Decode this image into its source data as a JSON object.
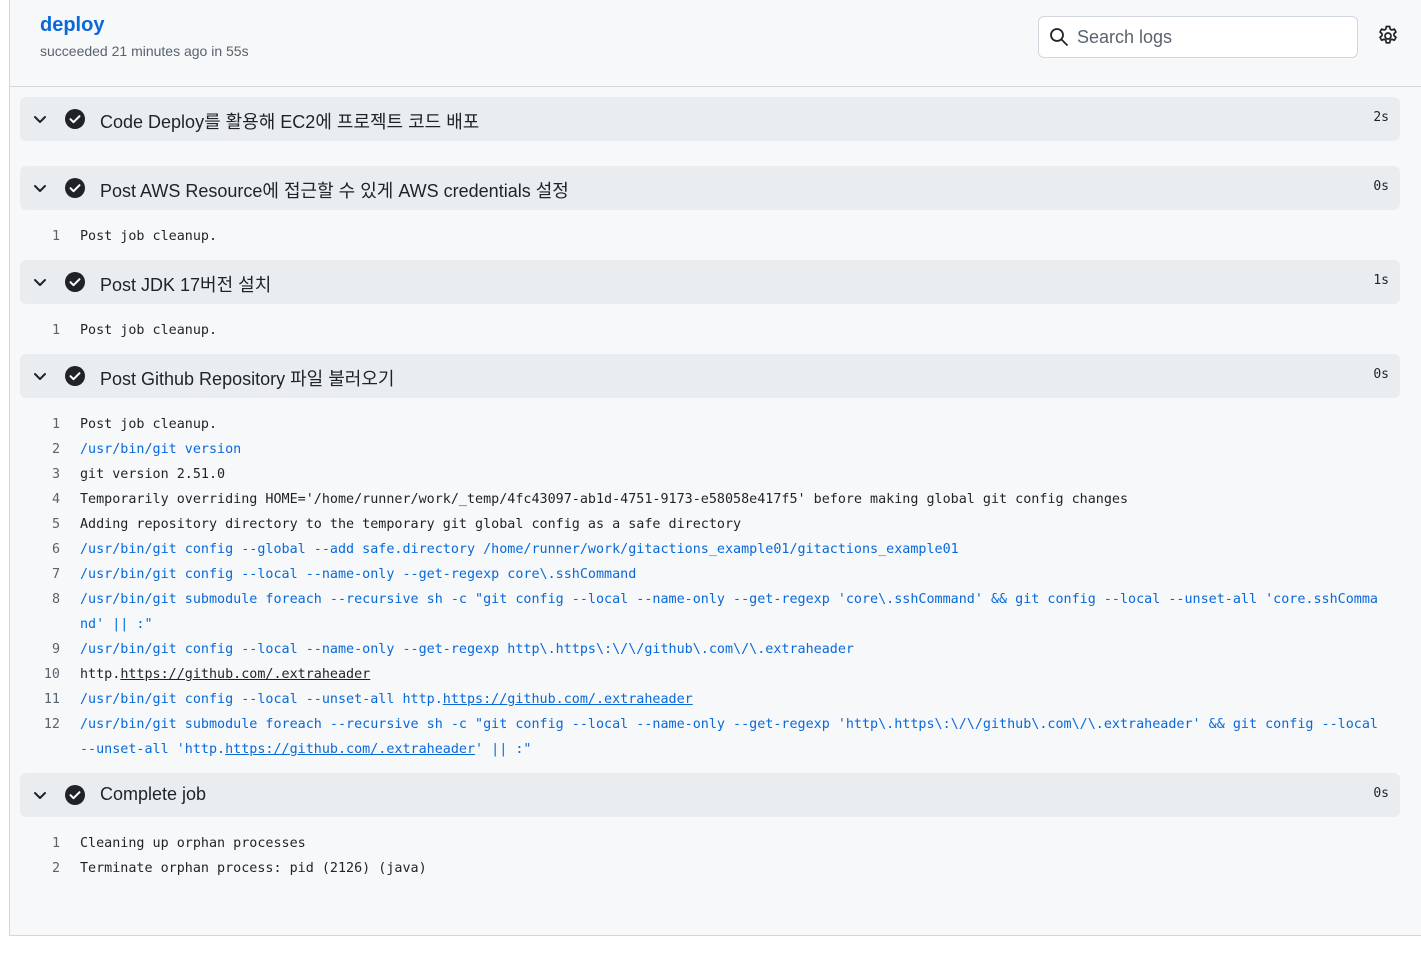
{
  "job": {
    "title": "deploy",
    "status": "succeeded 21 minutes ago in 55s"
  },
  "search": {
    "placeholder": "Search logs",
    "icon": "search-icon"
  },
  "settings": {
    "icon": "gear-icon"
  },
  "colors": {
    "link": "#0969da",
    "success": "#1f2328",
    "step_header_bg": "#eaedf0",
    "panel_bg": "#f6f8fa"
  },
  "steps": [
    {
      "name": "Code Deploy를 활용해 EC2에 프로젝트 코드 배포",
      "duration": "2s",
      "lines": []
    },
    {
      "name": "Post AWS Resource에 접근할 수 있게 AWS credentials 설정",
      "duration": "0s",
      "lines": [
        {
          "n": "1",
          "text": "Post job cleanup."
        }
      ]
    },
    {
      "name": "Post JDK 17버전 설치",
      "duration": "1s",
      "lines": [
        {
          "n": "1",
          "text": "Post job cleanup."
        }
      ]
    },
    {
      "name": "Post Github Repository 파일 불러오기",
      "duration": "0s",
      "lines": [
        {
          "n": "1",
          "text": "Post job cleanup."
        },
        {
          "n": "2",
          "text": "/usr/bin/git version"
        },
        {
          "n": "3",
          "text": "git version 2.51.0"
        },
        {
          "n": "4",
          "text": "Temporarily overriding HOME='/home/runner/work/_temp/4fc43097-ab1d-4751-9173-e58058e417f5' before making global git config changes"
        },
        {
          "n": "5",
          "text": "Adding repository directory to the temporary git global config as a safe directory"
        },
        {
          "n": "6",
          "text": "/usr/bin/git config --global --add safe.directory /home/runner/work/gitactions_example01/gitactions_example01"
        },
        {
          "n": "7",
          "text": "/usr/bin/git config --local --name-only --get-regexp core\\.sshCommand"
        },
        {
          "n": "8",
          "text": "/usr/bin/git submodule foreach --recursive sh -c \"git config --local --name-only --get-regexp 'core\\.sshCommand' && git config --local --unset-all 'core.sshCommand' || :\""
        },
        {
          "n": "9",
          "text": "/usr/bin/git config --local --name-only --get-regexp http\\.https\\:\\/\\/github\\.com\\/\\.extraheader"
        },
        {
          "n": "10",
          "text_pre": "http.",
          "link": "https://github.com/.extraheader",
          "text_post": ""
        },
        {
          "n": "11",
          "text_pre": "/usr/bin/git config --local --unset-all http.",
          "link": "https://github.com/.extraheader",
          "text_post": ""
        },
        {
          "n": "12",
          "text_pre": "/usr/bin/git submodule foreach --recursive sh -c \"git config --local --name-only --get-regexp 'http\\.https\\:\\/\\/github\\.com\\/\\.extraheader' && git config --local --unset-all 'http.",
          "link": "https://github.com/.extraheader",
          "text_post": "' || :\""
        }
      ]
    },
    {
      "name": "Complete job",
      "duration": "0s",
      "lines": [
        {
          "n": "1",
          "text": "Cleaning up orphan processes"
        },
        {
          "n": "2",
          "text": "Terminate orphan process: pid (2126) (java)"
        }
      ]
    }
  ]
}
